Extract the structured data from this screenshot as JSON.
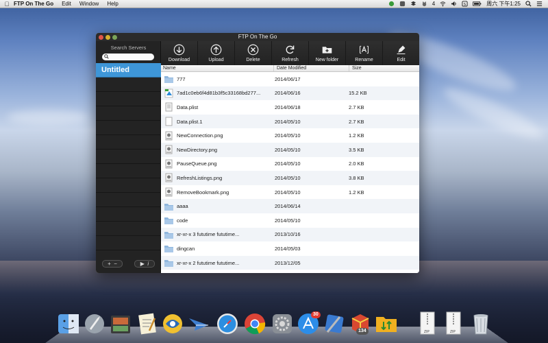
{
  "menubar": {
    "app_name": "FTP On The Go",
    "menus": [
      "Edit",
      "Window",
      "Help"
    ],
    "clock": "周六 下午1:25",
    "status_count": "4"
  },
  "window": {
    "title": "FTP On The Go",
    "search_label": "Search Servers",
    "search_placeholder": "",
    "servers": [
      "Untitled"
    ],
    "sidebar_add": "+",
    "sidebar_remove": "−",
    "sidebar_play": "▶",
    "sidebar_info": "i"
  },
  "toolbar": {
    "download": "Download",
    "upload": "Upload",
    "delete": "Delete",
    "refresh": "Refresh",
    "new_folder": "New folder",
    "rename": "Rename",
    "edit": "Edit"
  },
  "filelist": {
    "headers": {
      "name": "Name",
      "date": "Date Modified",
      "size": "Size"
    },
    "rows": [
      {
        "name": "777",
        "date": "2014/06/17",
        "size": "",
        "icon": "folder-icon"
      },
      {
        "name": "7ad1c0eb6f4d81b3f5c33168bd277...",
        "date": "2014/06/16",
        "size": "15.2 KB",
        "icon": "app-file-icon"
      },
      {
        "name": "Data.plist",
        "date": "2014/06/18",
        "size": "2.7 KB",
        "icon": "plist-icon"
      },
      {
        "name": "Data.plist.1",
        "date": "2014/05/10",
        "size": "2.7 KB",
        "icon": "document-icon"
      },
      {
        "name": "NewConnection.png",
        "date": "2014/05/10",
        "size": "1.2 KB",
        "icon": "image-file-icon"
      },
      {
        "name": "NewDirectory.png",
        "date": "2014/05/10",
        "size": "3.5 KB",
        "icon": "image-file-icon"
      },
      {
        "name": "PauseQueue.png",
        "date": "2014/05/10",
        "size": "2.0 KB",
        "icon": "image-file-icon"
      },
      {
        "name": "RefreshListings.png",
        "date": "2014/05/10",
        "size": "3.8 KB",
        "icon": "image-file-icon"
      },
      {
        "name": "RemoveBookmark.png",
        "date": "2014/05/10",
        "size": "1.2 KB",
        "icon": "image-file-icon"
      },
      {
        "name": "aaaa",
        "date": "2014/06/14",
        "size": "",
        "icon": "folder-icon"
      },
      {
        "name": "code",
        "date": "2014/05/10",
        "size": "",
        "icon": "folder-icon"
      },
      {
        "name": "xr-xr-x   3 fututime   fututime...",
        "date": "2013/10/16",
        "size": "",
        "icon": "folder-icon"
      },
      {
        "name": "dingcan",
        "date": "2014/05/03",
        "size": "",
        "icon": "folder-icon"
      },
      {
        "name": "xr-xr-x   2 fututime   fututime...",
        "date": "2013/12/05",
        "size": "",
        "icon": "folder-icon"
      }
    ]
  },
  "dock": {
    "appstore_badge": "30",
    "app_badge": "134",
    "zip_label": "ZIP"
  },
  "colors": {
    "accent": "#3e96d8",
    "toolbar": "#2a2a2a",
    "sidebar": "#232323"
  }
}
